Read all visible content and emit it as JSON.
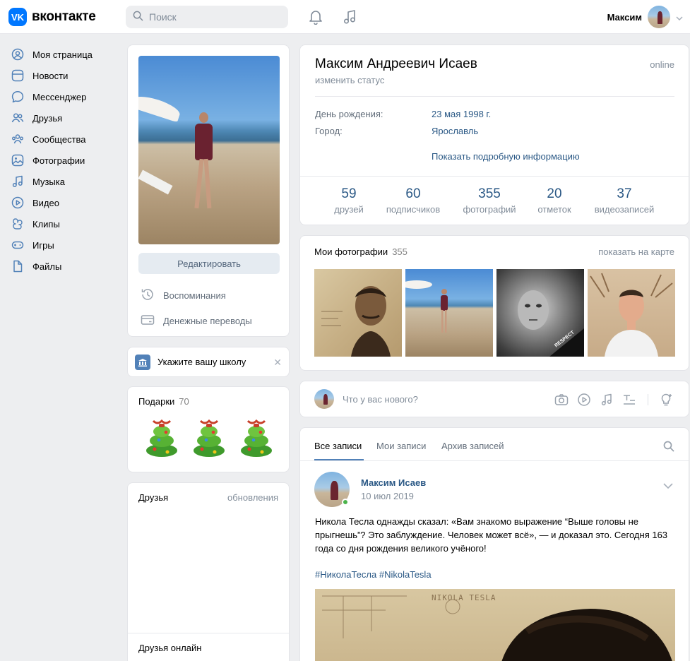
{
  "header": {
    "logo_text": "вконтакте",
    "logo_mark": "VK",
    "search_placeholder": "Поиск",
    "user_name": "Максим"
  },
  "nav": {
    "items": [
      {
        "label": "Моя страница",
        "icon": "profile-icon"
      },
      {
        "label": "Новости",
        "icon": "news-icon"
      },
      {
        "label": "Мессенджер",
        "icon": "message-icon"
      },
      {
        "label": "Друзья",
        "icon": "friends-icon"
      },
      {
        "label": "Сообщества",
        "icon": "groups-icon"
      },
      {
        "label": "Фотографии",
        "icon": "photos-icon"
      },
      {
        "label": "Музыка",
        "icon": "music-icon"
      },
      {
        "label": "Видео",
        "icon": "video-icon"
      },
      {
        "label": "Клипы",
        "icon": "clips-icon"
      },
      {
        "label": "Игры",
        "icon": "games-icon"
      },
      {
        "label": "Файлы",
        "icon": "files-icon"
      }
    ]
  },
  "profile_card": {
    "edit_label": "Редактировать",
    "memories_label": "Воспоминания",
    "transfers_label": "Денежные переводы"
  },
  "school": {
    "label": "Укажите вашу школу"
  },
  "gifts": {
    "title": "Подарки",
    "count": "70"
  },
  "friends": {
    "title": "Друзья",
    "updates_label": "обновления",
    "online_title": "Друзья онлайн"
  },
  "profile": {
    "name": "Максим Андреевич Исаев",
    "status_link": "изменить статус",
    "online": "online",
    "birthday_label": "День рождения:",
    "birthday_value": "23 мая 1998 г.",
    "city_label": "Город:",
    "city_value": "Ярославль",
    "more_info": "Показать подробную информацию"
  },
  "counters": [
    {
      "num": "59",
      "label": "друзей"
    },
    {
      "num": "60",
      "label": "подписчиков"
    },
    {
      "num": "355",
      "label": "фотографий"
    },
    {
      "num": "20",
      "label": "отметок"
    },
    {
      "num": "37",
      "label": "видеозаписей"
    }
  ],
  "photos": {
    "title": "Мои фотографии",
    "count": "355",
    "map_link": "показать на карте",
    "thumb3_caption": "RESPECT"
  },
  "composer": {
    "placeholder": "Что у вас нового?"
  },
  "wall": {
    "tabs": [
      "Все записи",
      "Мои записи",
      "Архив записей"
    ],
    "post": {
      "author": "Максим Исаев",
      "date": "10 июл 2019",
      "text": "Никола Тесла однажды сказал: «Вам знакомо выражение “Выше головы не прыгнешь”? Это заблуждение. Человек может всё», — и доказал это. Сегодня 163 года со дня рождения великого учёного!",
      "tags": "#НиколаТесла #NikolaTesla",
      "image_caption": "NIKOLA TESLA"
    }
  },
  "colors": {
    "accent": "#0077ff",
    "link": "#2a5885",
    "secondary": "#818c99",
    "background": "#edeef0",
    "online_dot": "#4bb34b"
  }
}
